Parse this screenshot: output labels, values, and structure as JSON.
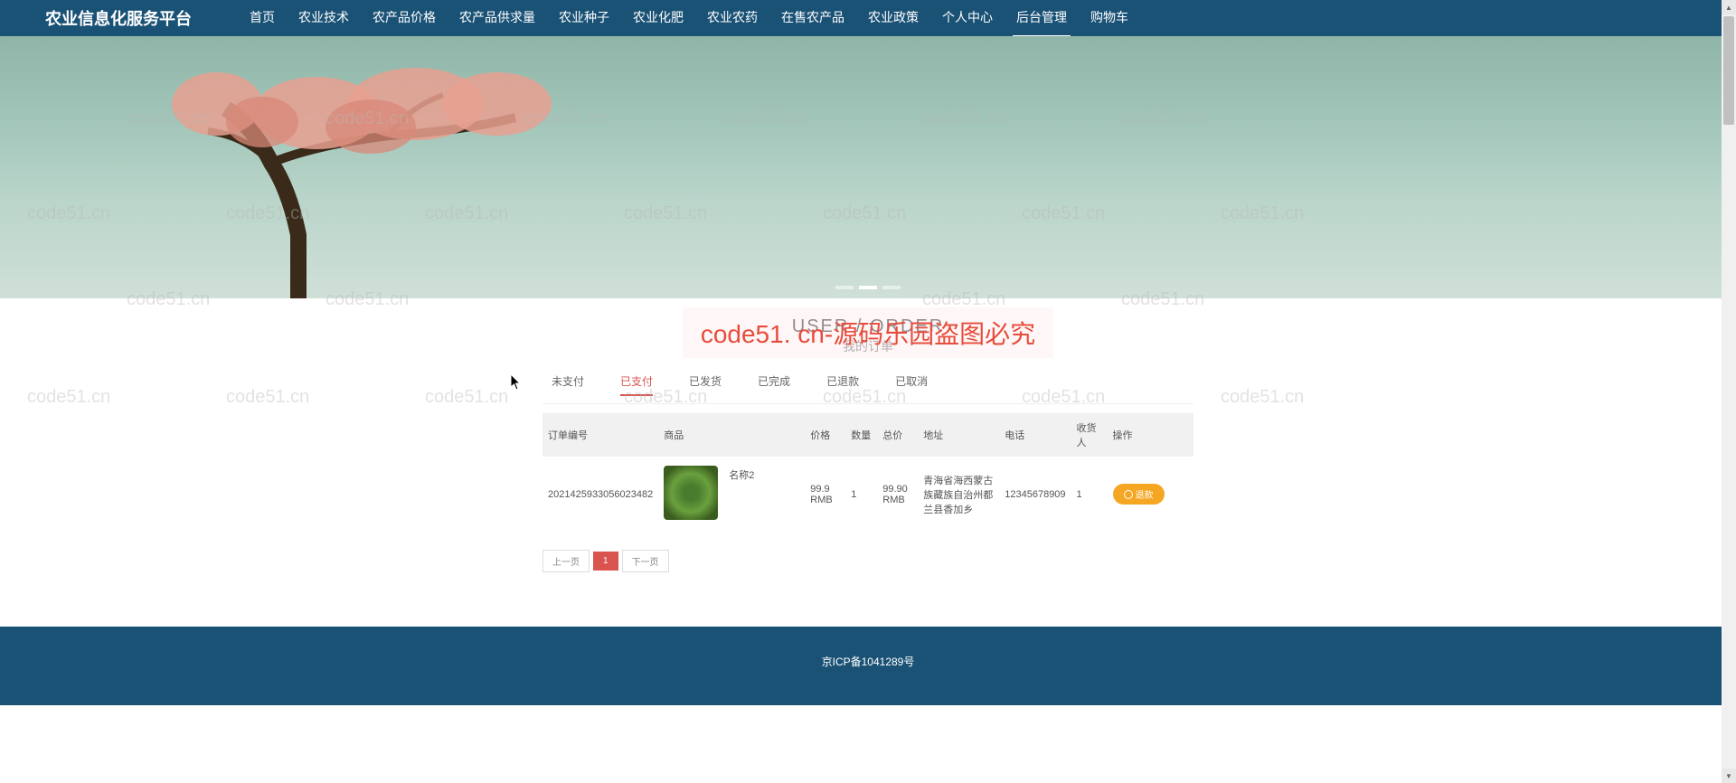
{
  "header": {
    "site_title": "农业信息化服务平台",
    "nav": [
      {
        "label": "首页"
      },
      {
        "label": "农业技术"
      },
      {
        "label": "农产品价格"
      },
      {
        "label": "农产品供求量"
      },
      {
        "label": "农业种子"
      },
      {
        "label": "农业化肥"
      },
      {
        "label": "农业农药"
      },
      {
        "label": "在售农产品"
      },
      {
        "label": "农业政策"
      },
      {
        "label": "个人中心"
      },
      {
        "label": "后台管理",
        "active": true
      },
      {
        "label": "购物车"
      }
    ]
  },
  "page": {
    "title_en": "USER / ORDER",
    "title_cn": "我的订单"
  },
  "overlay_text": "code51. cn-源码乐园盗图必究",
  "watermark_text": "code51.cn",
  "tabs": [
    {
      "label": "未支付"
    },
    {
      "label": "已支付",
      "active": true
    },
    {
      "label": "已发货"
    },
    {
      "label": "已完成"
    },
    {
      "label": "已退款"
    },
    {
      "label": "已取消"
    }
  ],
  "table": {
    "headers": [
      "订单编号",
      "商品",
      "",
      "价格",
      "数量",
      "总价",
      "地址",
      "电话",
      "收货人",
      "操作"
    ],
    "rows": [
      {
        "order_no": "2021425933056023482",
        "product_name": "名称2",
        "price": "99.9 RMB",
        "qty": "1",
        "total": "99.90 RMB",
        "address": "青海省海西蒙古族藏族自治州都兰县香加乡",
        "phone": "12345678909",
        "receiver": "1",
        "action": "退款"
      }
    ]
  },
  "pagination": {
    "prev": "上一页",
    "current": "1",
    "next": "下一页"
  },
  "footer": {
    "icp": "京ICP备1041289号"
  }
}
